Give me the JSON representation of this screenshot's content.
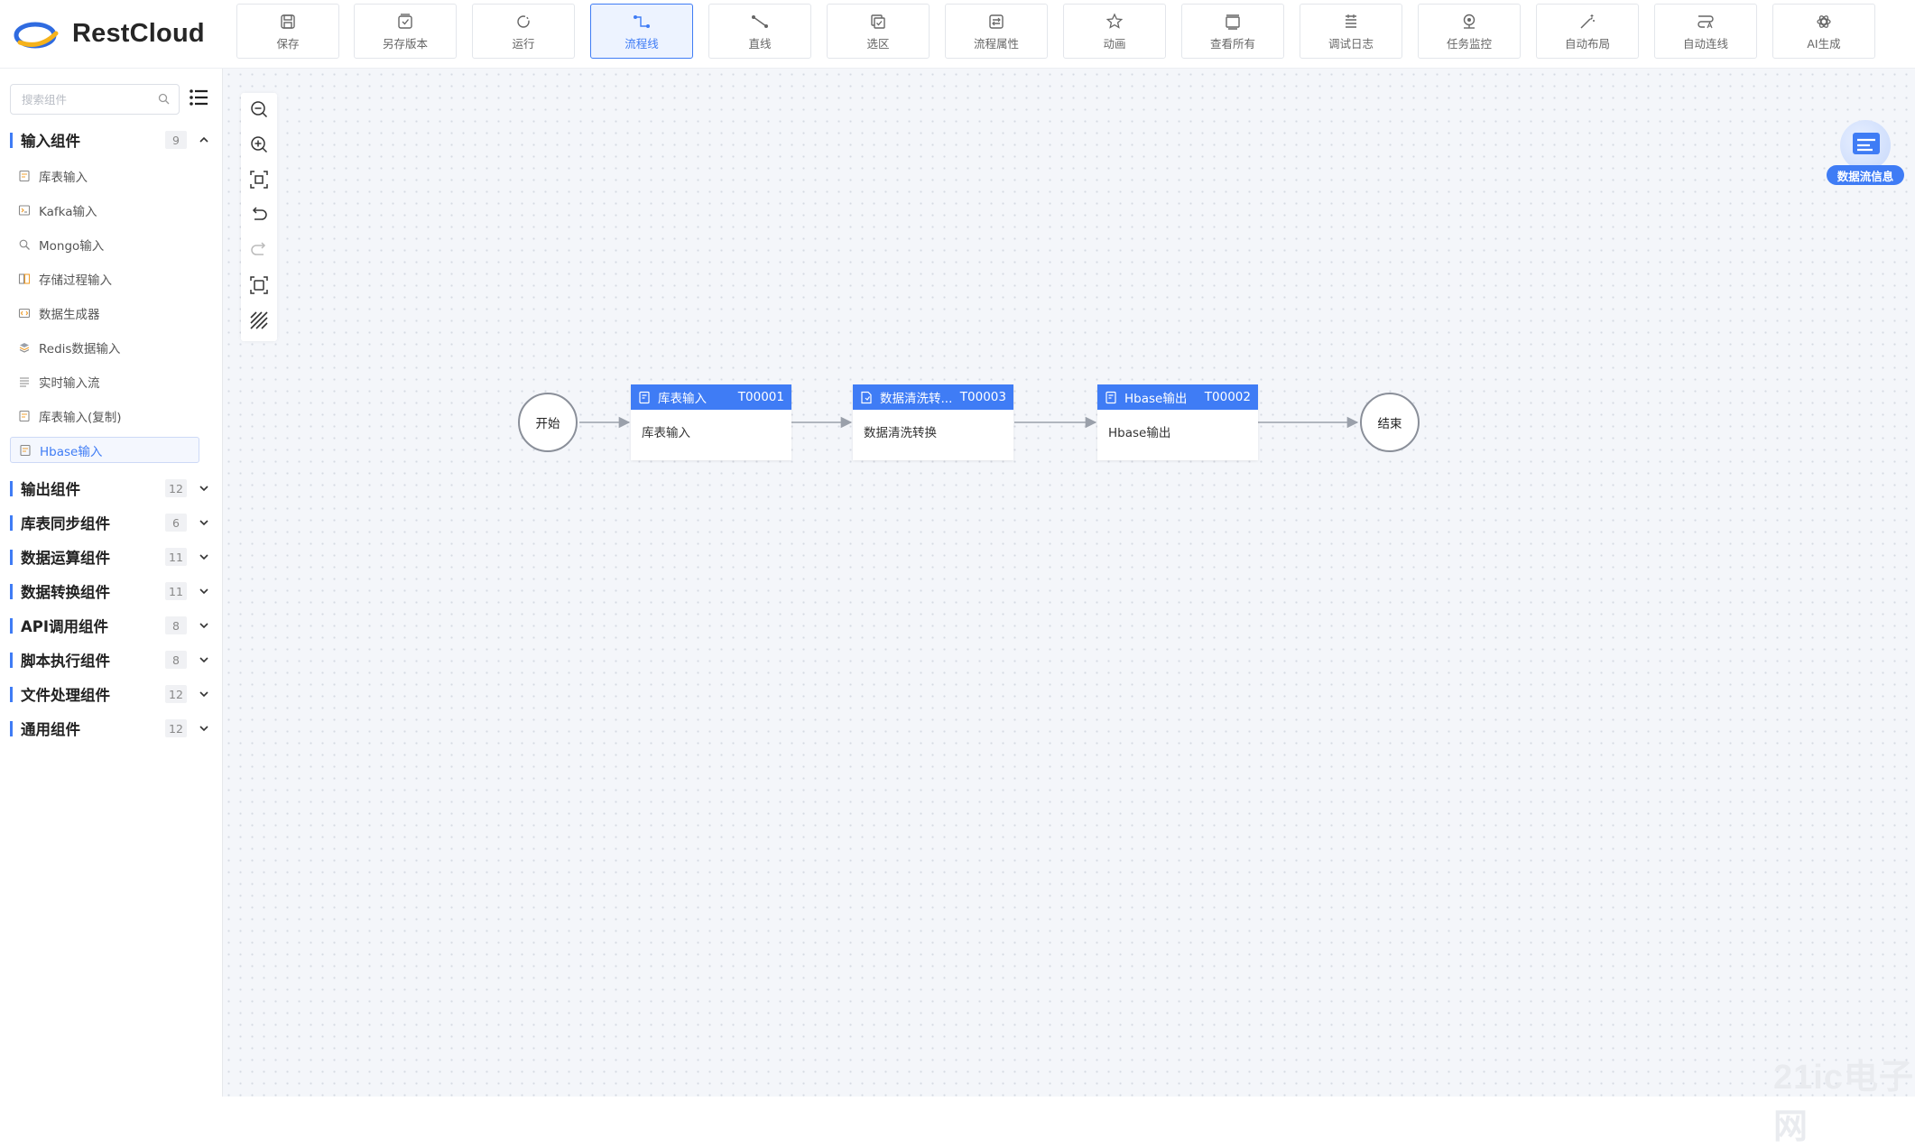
{
  "app": {
    "name": "RestCloud"
  },
  "toolbar": {
    "buttons": [
      {
        "label": "保存",
        "icon": "save-icon"
      },
      {
        "label": "另存版本",
        "icon": "save-version-icon"
      },
      {
        "label": "运行",
        "icon": "run-icon"
      },
      {
        "label": "流程线",
        "icon": "flow-line-icon",
        "active": true
      },
      {
        "label": "直线",
        "icon": "straight-line-icon"
      },
      {
        "label": "选区",
        "icon": "selection-icon"
      },
      {
        "label": "流程属性",
        "icon": "flow-properties-icon"
      },
      {
        "label": "动画",
        "icon": "animation-icon"
      },
      {
        "label": "查看所有",
        "icon": "view-all-icon"
      },
      {
        "label": "调试日志",
        "icon": "debug-log-icon"
      },
      {
        "label": "任务监控",
        "icon": "task-monitor-icon"
      },
      {
        "label": "自动布局",
        "icon": "auto-layout-icon"
      },
      {
        "label": "自动连线",
        "icon": "auto-connect-icon"
      },
      {
        "label": "AI生成",
        "icon": "ai-generate-icon"
      }
    ]
  },
  "sidebar": {
    "search": {
      "placeholder": "搜索组件",
      "value": ""
    },
    "groups": [
      {
        "label": "输入组件",
        "count": "9",
        "expanded": true,
        "items": [
          {
            "label": "库表输入"
          },
          {
            "label": "Kafka输入"
          },
          {
            "label": "Mongo输入"
          },
          {
            "label": "存储过程输入"
          },
          {
            "label": "数据生成器"
          },
          {
            "label": "Redis数据输入"
          },
          {
            "label": "实时输入流"
          },
          {
            "label": "库表输入(复制)"
          },
          {
            "label": "Hbase输入",
            "selected": true
          }
        ]
      },
      {
        "label": "输出组件",
        "count": "12"
      },
      {
        "label": "库表同步组件",
        "count": "6"
      },
      {
        "label": "数据运算组件",
        "count": "11"
      },
      {
        "label": "数据转换组件",
        "count": "11"
      },
      {
        "label": "API调用组件",
        "count": "8"
      },
      {
        "label": "脚本执行组件",
        "count": "8"
      },
      {
        "label": "文件处理组件",
        "count": "12"
      },
      {
        "label": "通用组件",
        "count": "12"
      }
    ]
  },
  "flow": {
    "start_label": "开始",
    "end_label": "结束",
    "nodes": [
      {
        "title": "库表输入",
        "id": "T00001",
        "body": "库表输入"
      },
      {
        "title": "数据清洗转...",
        "id": "T00003",
        "body": "数据清洗转换"
      },
      {
        "title": "Hbase输出",
        "id": "T00002",
        "body": "Hbase输出"
      }
    ]
  },
  "info_widget": {
    "label": "数据流信息"
  },
  "watermark": "21ic电子网",
  "colors": {
    "accent": "#3f7cf5",
    "canvas_bg": "#f4f6fa",
    "edge": "#9aa0aa"
  }
}
